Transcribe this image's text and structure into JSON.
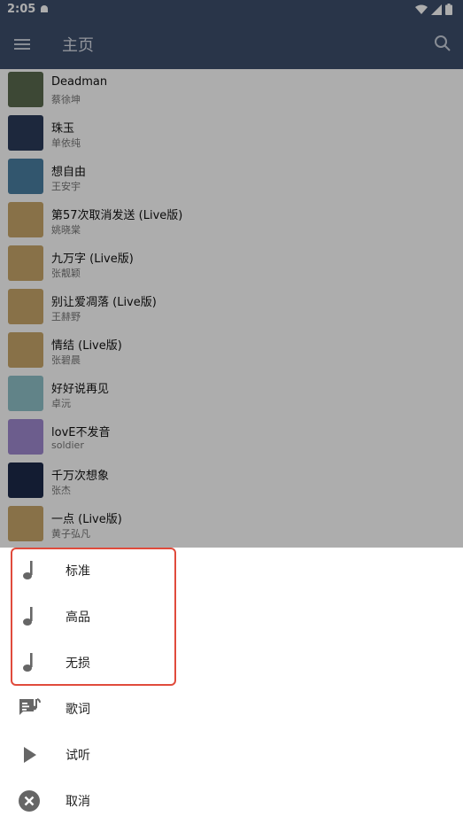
{
  "status_bar": {
    "time": "2:05"
  },
  "app_bar": {
    "title": "主页"
  },
  "songs": [
    {
      "name": "Deadman",
      "artist": "蔡徐坤",
      "cover_color": "#5a6a4e"
    },
    {
      "name": "珠玉",
      "artist": "单依纯",
      "cover_color": "#2b3b5a"
    },
    {
      "name": "想自由",
      "artist": "王安宇",
      "cover_color": "#4b7fa3"
    },
    {
      "name": "第57次取消发送 (Live版)",
      "artist": "姚晓棠",
      "cover_color": "#c9a76b"
    },
    {
      "name": "九万字 (Live版)",
      "artist": "张靓颖",
      "cover_color": "#c9a76b"
    },
    {
      "name": "别让爱凋落 (Live版)",
      "artist": "王赫野",
      "cover_color": "#c9a76b"
    },
    {
      "name": "情结 (Live版)",
      "artist": "张碧晨",
      "cover_color": "#c9a76b"
    },
    {
      "name": "好好说再见",
      "artist": "卓沅",
      "cover_color": "#8fc2c9"
    },
    {
      "name": "lovE不发音",
      "artist": "soldier",
      "cover_color": "#a08ad0"
    },
    {
      "name": "千万次想象",
      "artist": "张杰",
      "cover_color": "#1d2a4a"
    },
    {
      "name": "一点 (Live版)",
      "artist": "黄子弘凡",
      "cover_color": "#c9a76b"
    }
  ],
  "sheet": {
    "items": [
      {
        "label": "标准",
        "icon": "music-note-icon"
      },
      {
        "label": "高品",
        "icon": "music-note-icon"
      },
      {
        "label": "无损",
        "icon": "music-note-icon"
      },
      {
        "label": "歌词",
        "icon": "lyrics-icon"
      },
      {
        "label": "试听",
        "icon": "play-icon"
      },
      {
        "label": "取消",
        "icon": "cancel-icon"
      }
    ]
  },
  "colors": {
    "app_bar": "#3d4e6c",
    "highlight": "#e04b3c",
    "icon_gray": "#666666"
  }
}
